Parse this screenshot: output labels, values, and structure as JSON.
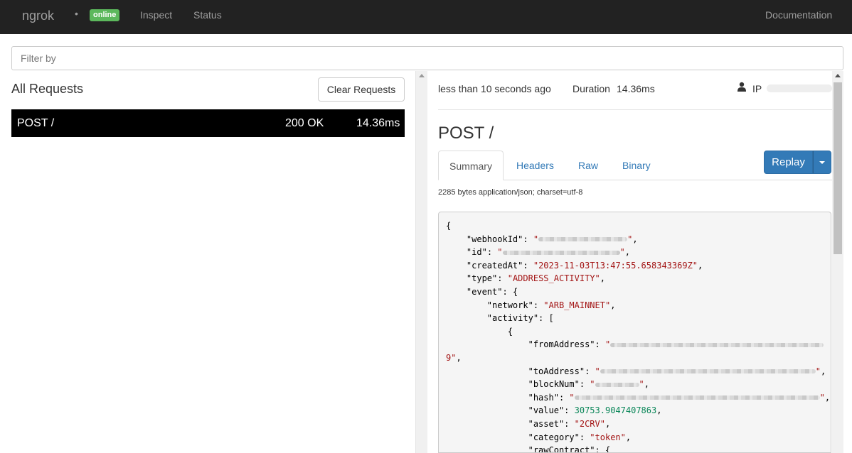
{
  "navbar": {
    "brand": "ngrok",
    "status_dot": "•",
    "status_badge": "online",
    "links": [
      "Inspect",
      "Status"
    ],
    "documentation": "Documentation",
    "badge_color": "#5cb85c"
  },
  "filter": {
    "placeholder": "Filter by",
    "value": ""
  },
  "requests": {
    "title": "All Requests",
    "clear_label": "Clear Requests",
    "items": [
      {
        "method_path": "POST /",
        "status": "200 OK",
        "duration": "14.36ms"
      }
    ]
  },
  "detail": {
    "time": "less than 10 seconds ago",
    "duration_label": "Duration",
    "duration_value": "14.36ms",
    "ip_label": "IP",
    "title": "POST /",
    "tabs": [
      "Summary",
      "Headers",
      "Raw",
      "Binary"
    ],
    "replay_label": "Replay",
    "size_info": "2285 bytes application/json; charset=utf-8",
    "body": {
      "open_brace": "{",
      "webhookId_key": "\"webhookId\"",
      "id_key": "\"id\"",
      "createdAt_key": "\"createdAt\"",
      "createdAt_value": "\"2023-11-03T13:47:55.658343369Z\"",
      "type_key": "\"type\"",
      "type_value": "\"ADDRESS_ACTIVITY\"",
      "event_key": "\"event\"",
      "network_key": "\"network\"",
      "network_value": "\"ARB_MAINNET\"",
      "activity_key": "\"activity\"",
      "fromAddress_key": "\"fromAddress\"",
      "fromAddress_tail": "9\"",
      "toAddress_key": "\"toAddress\"",
      "blockNum_key": "\"blockNum\"",
      "hash_key": "\"hash\"",
      "value_key": "\"value\"",
      "value_value": "30753.9047407863",
      "asset_key": "\"asset\"",
      "asset_value": "\"2CRV\"",
      "category_key": "\"category\"",
      "category_value": "\"token\"",
      "rawContract_key": "\"rawContract\""
    }
  }
}
